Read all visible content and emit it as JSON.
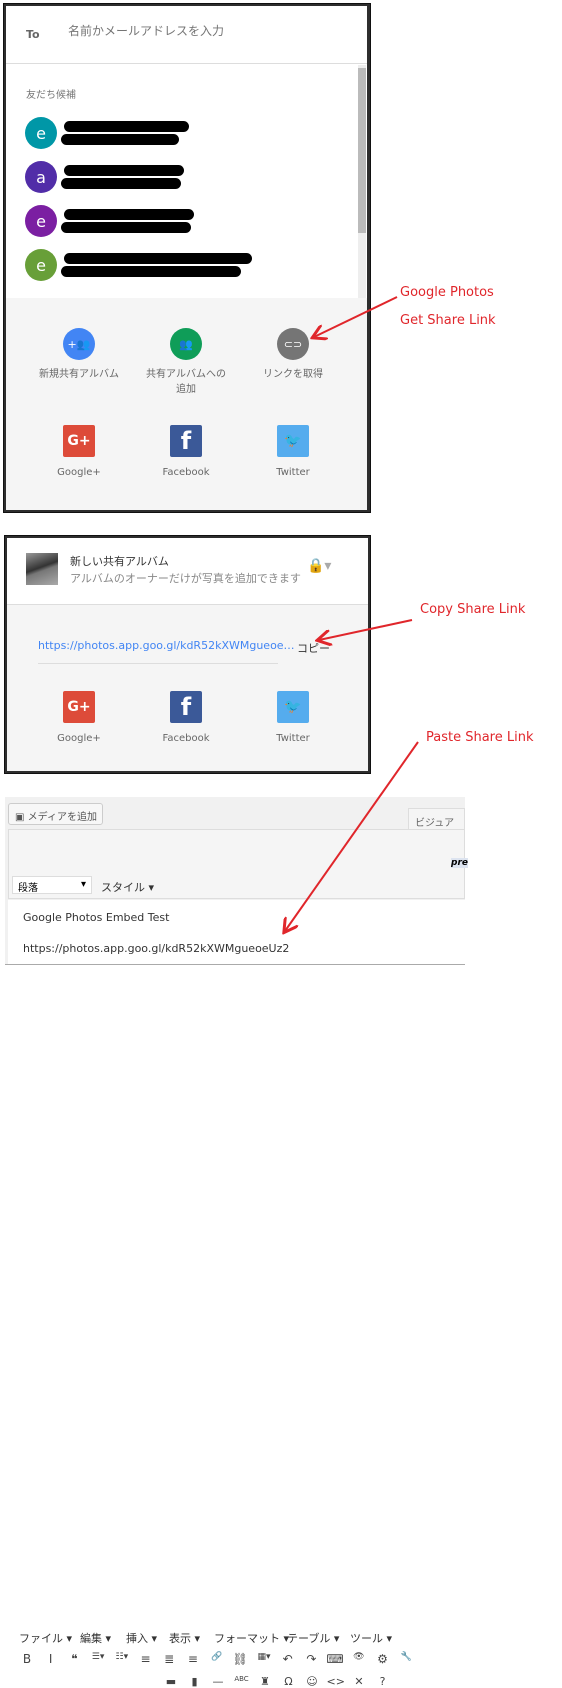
{
  "share_dialog": {
    "to_label": "To",
    "to_placeholder": "名前かメールアドレスを入力",
    "suggestions_title": "友だち候補",
    "contacts": [
      {
        "initial": "e",
        "color": "#0097a7"
      },
      {
        "initial": "a",
        "color": "#512da8"
      },
      {
        "initial": "e",
        "color": "#7b1fa2"
      },
      {
        "initial": "e",
        "color": "#689f38"
      }
    ],
    "actions": [
      {
        "label": "新規共有アルバム",
        "icon": "add-people-icon",
        "color": "#4285f4"
      },
      {
        "label": "共有アルバムへの追加",
        "icon": "people-icon",
        "color": "#0f9d58"
      },
      {
        "label": "リンクを取得",
        "icon": "link-icon",
        "color": "#757575"
      }
    ],
    "social": [
      {
        "label": "Google+",
        "glyph": "G+",
        "color": "#dd4b39"
      },
      {
        "label": "Facebook",
        "glyph": "f",
        "color": "#3b5998"
      },
      {
        "label": "Twitter",
        "glyph": "🐦",
        "color": "#55acee"
      }
    ]
  },
  "link_dialog": {
    "album_title": "新しい共有アルバム",
    "album_subtitle": "アルバムのオーナーだけが写真を追加できます",
    "link": "https://photos.app.goo.gl/kdR52kXWMgueoe…",
    "copy_label": "コピー",
    "social": [
      {
        "label": "Google+",
        "glyph": "G+"
      },
      {
        "label": "Facebook",
        "glyph": "f"
      },
      {
        "label": "Twitter",
        "glyph": "🐦"
      }
    ]
  },
  "editor": {
    "add_media": "メディアを追加",
    "visual_tab": "ビジュアル",
    "menu": [
      "ファイル ▾",
      "編集 ▾",
      "挿入 ▾",
      "表示 ▾",
      "フォーマット ▾",
      "テーブル ▾",
      "ツール ▾"
    ],
    "toolbar1": [
      "B",
      "I",
      "❝",
      "☰▾",
      "☷▾",
      "≡",
      "≣",
      "≡",
      "🔗",
      "⛓",
      "▦▾",
      "↶",
      "↷",
      "⌨",
      "👁",
      "⚙",
      "🔧"
    ],
    "pre": "pre",
    "format_select": "段落",
    "style_menu": "スタイル ▾",
    "toolbar2": [
      "▬",
      "▮",
      "—",
      "ABC",
      "♜",
      "Ω",
      "☺",
      "<>",
      "✕",
      "?"
    ],
    "content": [
      "Google Photos Embed Test",
      "https://photos.app.goo.gl/kdR52kXWMgueoeUz2"
    ]
  },
  "annotations": {
    "get_link_1": "Google Photos",
    "get_link_2": "Get Share Link",
    "copy": "Copy Share Link",
    "paste": "Paste Share Link"
  }
}
